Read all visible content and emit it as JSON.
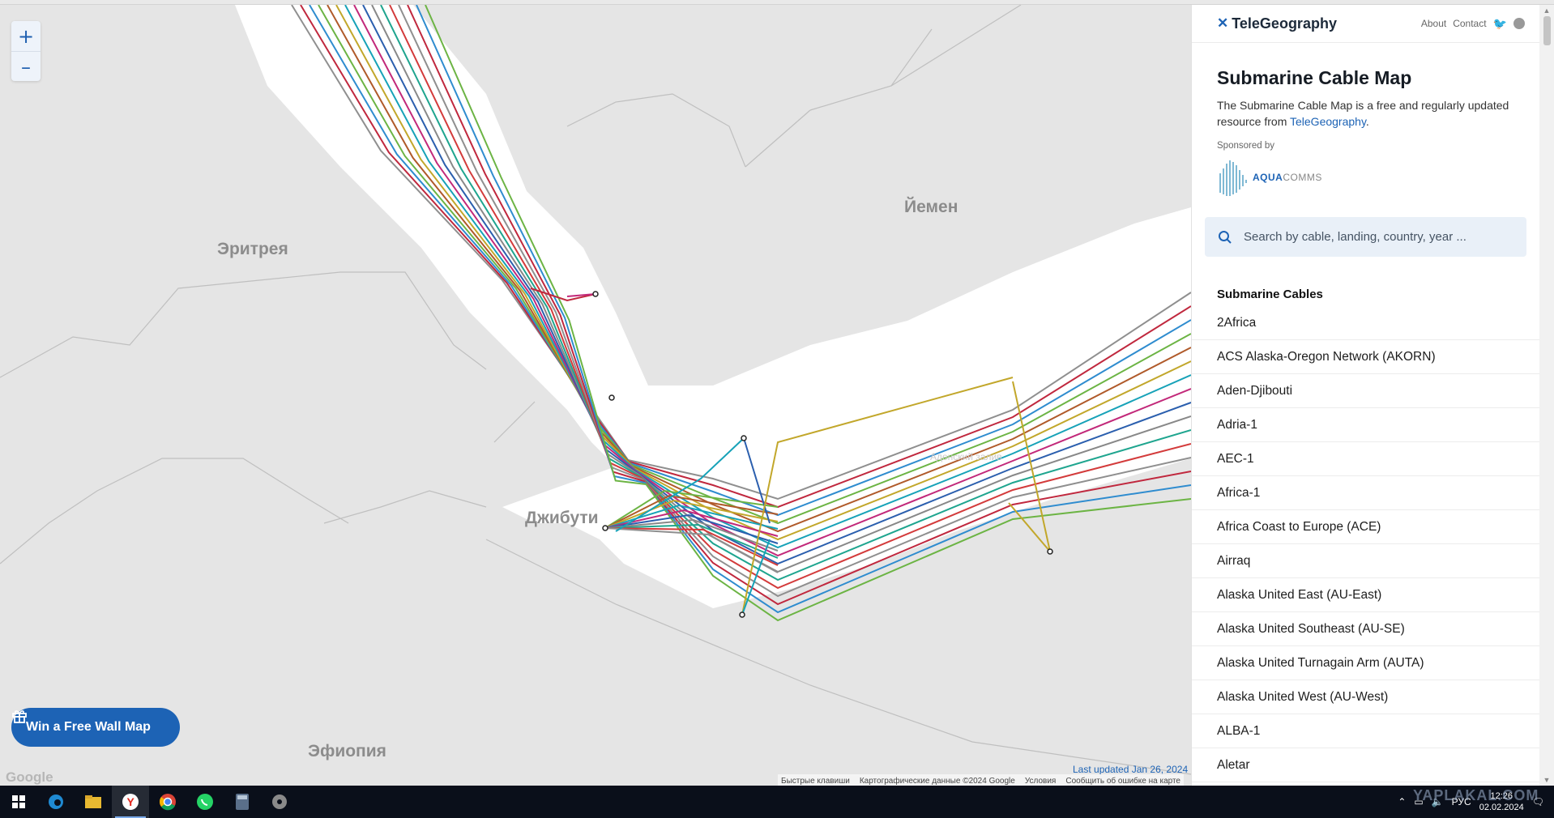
{
  "map": {
    "zoom_in": "+",
    "zoom_out": "–",
    "countries": [
      "Эритрея",
      "Йемен",
      "Джибути",
      "Эфиопия"
    ],
    "sea_label": "Аденский залив",
    "win_button": "Win a Free Wall Map",
    "google": "Google",
    "last_updated": "Last updated Jan 26, 2024",
    "attribution": [
      "Быстрые клавиши",
      "Картографические данные ©2024 Google",
      "Условия",
      "Сообщить об ошибке на карте"
    ],
    "cable_colors": [
      "#8f8f8f",
      "#c0283e",
      "#2f8ccf",
      "#6cb444",
      "#b05a2a",
      "#c2a72b",
      "#17a2b8",
      "#c2297a",
      "#2b5fae",
      "#888888",
      "#1fa58f",
      "#d33b3b"
    ]
  },
  "sidebar": {
    "brand": "TeleGeography",
    "links": [
      "About",
      "Contact"
    ],
    "title": "Submarine Cable Map",
    "desc_prefix": "The Submarine Cable Map is a free and regularly updated resource from ",
    "desc_link": "TeleGeography",
    "desc_suffix": ".",
    "sponsored": "Sponsored by",
    "sponsor_bold": "AQUA",
    "sponsor_light": "COMMS",
    "search_placeholder": "Search by cable, landing, country, year ...",
    "list_title": "Submarine Cables",
    "cables": [
      "2Africa",
      "ACS Alaska-Oregon Network (AKORN)",
      "Aden-Djibouti",
      "Adria-1",
      "AEC-1",
      "Africa-1",
      "Africa Coast to Europe (ACE)",
      "Airraq",
      "Alaska United East (AU-East)",
      "Alaska United Southeast (AU-SE)",
      "Alaska United Turnagain Arm (AUTA)",
      "Alaska United West (AU-West)",
      "ALBA-1",
      "Aletar"
    ]
  },
  "taskbar": {
    "lang": "РУС",
    "time": "12:26",
    "date": "02.02.2024",
    "watermark": "YAPLAKAL.COM"
  }
}
